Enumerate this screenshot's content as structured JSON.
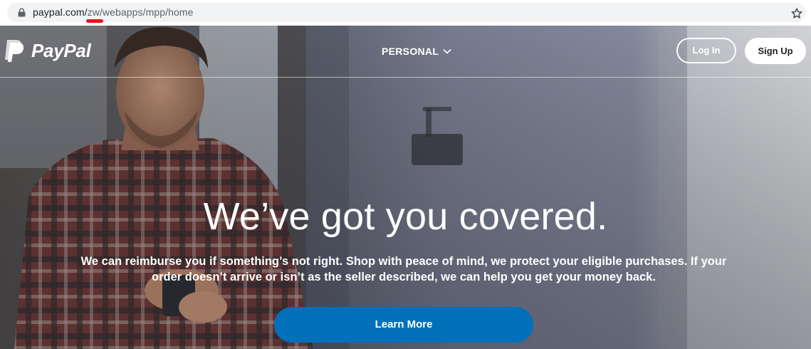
{
  "browser": {
    "url_host": "paypal.com/",
    "url_path": "zw/webapps/mpp/home"
  },
  "header": {
    "logo_text": "PayPal",
    "nav_personal": "PERSONAL",
    "login_label": "Log In",
    "signup_label": "Sign Up"
  },
  "hero": {
    "headline": "We’ve got you covered.",
    "subtext_line1": "We can reimburse you if something’s not right. Shop with peace of mind, we protect your eligible purchases. If your",
    "subtext_line2": "order doesn’t arrive or isn’t as the seller described, we can help you get your money back.",
    "cta_label": "Learn More"
  },
  "colors": {
    "cta_blue": "#0070ba",
    "url_underline_red": "#e8141d",
    "address_bar_bg": "#f1f3f4"
  },
  "icons": {
    "lock": "lock-icon",
    "star": "star-icon",
    "chevron": "chevron-down-icon",
    "logo": "paypal-logo-icon"
  }
}
